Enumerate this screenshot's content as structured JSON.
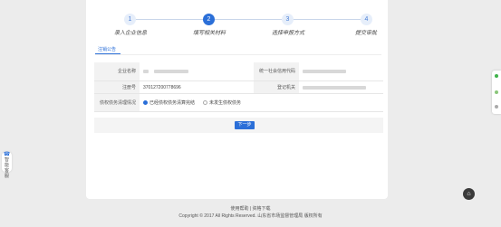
{
  "steps": [
    {
      "num": "1",
      "label": "录入企业信息"
    },
    {
      "num": "2",
      "label": "填写相关材料"
    },
    {
      "num": "3",
      "label": "选择申报方式"
    },
    {
      "num": "4",
      "label": "提交审批"
    }
  ],
  "tab": {
    "label": "注销公告"
  },
  "form": {
    "company_name_label": "企业名称",
    "credit_code_label": "统一社会信用代码",
    "reg_no_label": "注册号",
    "reg_no_value": "370127200778696",
    "reg_office_label": "登记机关",
    "debt_label": "债权债务清理情况",
    "option1": "已经债权债务清算完结",
    "option2": "未发生债权债务"
  },
  "buttons": {
    "next": "下一步"
  },
  "footer": {
    "links": "使用帮助 | 资格下载",
    "copyright": "Copyright © 2017 All Rights Reserved. 山东省市场监督管理局 版权所有"
  },
  "float_left": {
    "label": "智能客服"
  },
  "colors": {
    "accent": "#2b6fd8",
    "background": "#ececec"
  }
}
